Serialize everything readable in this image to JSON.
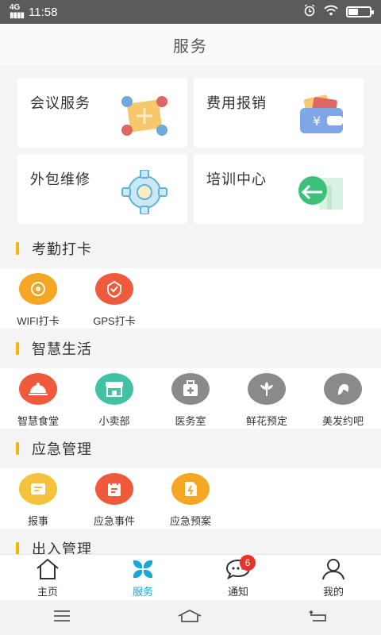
{
  "status": {
    "signal": "4G",
    "time": "11:58"
  },
  "header": {
    "title": "服务"
  },
  "cards": [
    {
      "title": "会议服务",
      "icon": "meeting-icon"
    },
    {
      "title": "费用报销",
      "icon": "wallet-icon"
    },
    {
      "title": "外包维修",
      "icon": "gear-icon"
    },
    {
      "title": "培训中心",
      "icon": "training-icon"
    }
  ],
  "sections": {
    "attendance": {
      "title": "考勤打卡",
      "items": [
        {
          "label": "WIFI打卡",
          "icon": "wifi-checkin-icon",
          "color": "#f5a623"
        },
        {
          "label": "GPS打卡",
          "icon": "gps-checkin-icon",
          "color": "#ef5a3c"
        }
      ]
    },
    "smart_life": {
      "title": "智慧生活",
      "items": [
        {
          "label": "智慧食堂",
          "icon": "canteen-icon",
          "color": "#ef5a3c"
        },
        {
          "label": "小卖部",
          "icon": "shop-icon",
          "color": "#42c2a5"
        },
        {
          "label": "医务室",
          "icon": "clinic-icon",
          "color": "#8a8a8a"
        },
        {
          "label": "鲜花预定",
          "icon": "flower-icon",
          "color": "#8a8a8a"
        },
        {
          "label": "美发约吧",
          "icon": "hair-icon",
          "color": "#8a8a8a"
        }
      ]
    },
    "emergency": {
      "title": "应急管理",
      "items": [
        {
          "label": "报事",
          "icon": "report-icon",
          "color": "#f5c33b"
        },
        {
          "label": "应急事件",
          "icon": "emergency-event-icon",
          "color": "#ef5a3c"
        },
        {
          "label": "应急预案",
          "icon": "emergency-plan-icon",
          "color": "#f5a623"
        }
      ]
    },
    "access": {
      "title": "出入管理"
    }
  },
  "tabbar": {
    "active": "服务",
    "tabs": [
      {
        "label": "主页",
        "icon": "home-icon"
      },
      {
        "label": "服务",
        "icon": "services-icon"
      },
      {
        "label": "通知",
        "icon": "chat-icon",
        "badge": "6"
      },
      {
        "label": "我的",
        "icon": "user-icon"
      }
    ]
  },
  "colors": {
    "accent": "#1aa6d8",
    "section_bar": "#f2b705",
    "badge": "#e8332a"
  }
}
